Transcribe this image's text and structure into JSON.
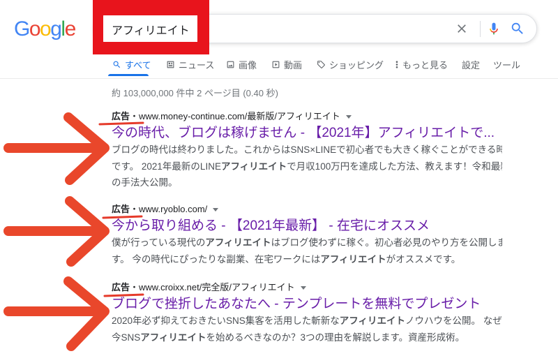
{
  "logo": {
    "letters": [
      "G",
      "o",
      "o",
      "g",
      "l",
      "e"
    ],
    "colors": [
      "#4285F4",
      "#EA4335",
      "#FBBC05",
      "#4285F4",
      "#34A853",
      "#EA4335"
    ]
  },
  "search": {
    "query": "アフィリエイト",
    "clear_icon": "close-icon",
    "voice_icon": "mic-icon",
    "submit_icon": "search-icon"
  },
  "tabs": [
    {
      "label": "すべて",
      "icon": "search-icon",
      "active": true
    },
    {
      "label": "ニュース",
      "icon": "news-icon"
    },
    {
      "label": "画像",
      "icon": "image-icon"
    },
    {
      "label": "動画",
      "icon": "play-icon"
    },
    {
      "label": "ショッピング",
      "icon": "tag-icon"
    },
    {
      "label": "もっと見る",
      "icon": "more-vert-icon"
    }
  ],
  "tools": {
    "settings_label": "設定",
    "tools_label": "ツール"
  },
  "result_stats": "約 103,000,000 件中 2 ページ目 (0.40 秒)",
  "ads": [
    {
      "badge": "広告",
      "separator": "・",
      "url": "www.money-continue.com/最新版/アフィリエイト",
      "title": "今の時代、ブログは稼げません - 【2021年】アフィリエイトで...",
      "description_lines": [
        [
          {
            "text": "ブログの時代は終わりました。これからはSNS×LINEで初心者でも大きく稼ぐことができる時代",
            "bold": false
          }
        ],
        [
          {
            "text": "です。 2021年最新のLINE",
            "bold": false
          },
          {
            "text": "アフィリエイト",
            "bold": true
          },
          {
            "text": "で月収100万円を達成した方法、教えます！令和最新",
            "bold": false
          }
        ],
        [
          {
            "text": "の手法大公開。",
            "bold": false
          }
        ]
      ]
    },
    {
      "badge": "広告",
      "separator": "・",
      "url": "www.ryoblo.com/",
      "title": "今から取り組める - 【2021年最新】 - 在宅にオススメ",
      "description_lines": [
        [
          {
            "text": "僕が行っている現代の",
            "bold": false
          },
          {
            "text": "アフィリエイト",
            "bold": true
          },
          {
            "text": "はブログ使わずに稼ぐ。初心者必見のやり方を公開しま",
            "bold": false
          }
        ],
        [
          {
            "text": "す。 今の時代にぴったりな副業、在宅ワークには",
            "bold": false
          },
          {
            "text": "アフィリエイト",
            "bold": true
          },
          {
            "text": "がオススメです。",
            "bold": false
          }
        ]
      ]
    },
    {
      "badge": "広告",
      "separator": "・",
      "url": "www.croixx.net/完全版/アフィリエイト",
      "title": "ブログで挫折したあなたへ - テンプレートを無料でプレゼント",
      "description_lines": [
        [
          {
            "text": "2020年必ず抑えておきたいSNS集客を活用した斬新な",
            "bold": false
          },
          {
            "text": "アフィリエイト",
            "bold": true
          },
          {
            "text": "ノウハウを公開。 なぜ、",
            "bold": false
          }
        ],
        [
          {
            "text": "今SNS",
            "bold": false
          },
          {
            "text": "アフィリエイト",
            "bold": true
          },
          {
            "text": "を始めるべきなのか？3つの理由を解説します。資産形成術。",
            "bold": false
          }
        ]
      ]
    }
  ],
  "colors": {
    "accent": "#1a73e8",
    "ad_title": "#681da8",
    "search_icon": "#4285f4",
    "annotation_box": "#e8141c",
    "annotation_arrow": "#e9472b",
    "annotation_underline": "#e53a2a"
  }
}
